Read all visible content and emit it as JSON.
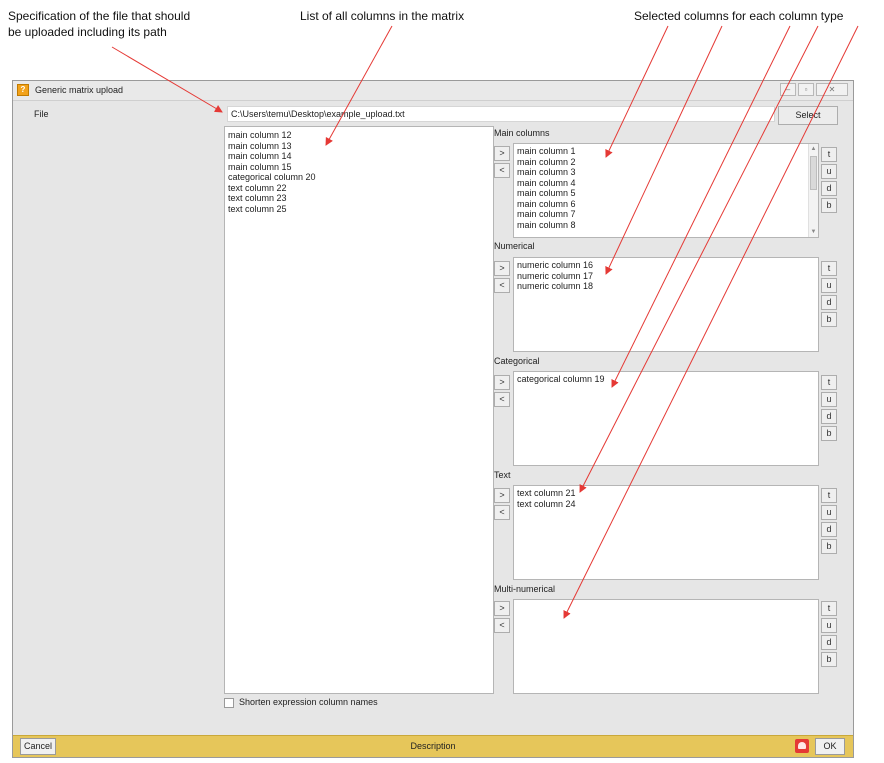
{
  "annotations": {
    "file_spec": [
      "Specification of the file that should",
      "be uploaded including its path"
    ],
    "all_columns": "List of all columns in the matrix",
    "selected_columns": "Selected columns for each column type"
  },
  "window": {
    "title": "Generic matrix upload",
    "app_icon": "app-logo-icon",
    "controls": [
      "minimize",
      "maximize",
      "close"
    ]
  },
  "file": {
    "label": "File",
    "path": "C:\\Users\\temu\\Desktop\\example_upload.txt",
    "select_label": "Select"
  },
  "all_columns": [
    "main column 12",
    "main column 13",
    "main column 14",
    "main column 15",
    "categorical column 20",
    "text column 22",
    "text column 23",
    "text column 25"
  ],
  "buttons": {
    "add": ">",
    "remove": "<",
    "top": "t",
    "up": "u",
    "down": "d",
    "bottom": "b"
  },
  "groups": [
    {
      "label": "Main columns",
      "items": [
        "main column 1",
        "main column 2",
        "main column 3",
        "main column 4",
        "main column 5",
        "main column 6",
        "main column 7",
        "main column 8"
      ],
      "scrollbar": true
    },
    {
      "label": "Numerical",
      "items": [
        "numeric column 16",
        "numeric column 17",
        "numeric column 18"
      ]
    },
    {
      "label": "Categorical",
      "items": [
        "categorical column 19"
      ]
    },
    {
      "label": "Text",
      "items": [
        "text column 21",
        "text column 24"
      ]
    },
    {
      "label": "Multi-numerical",
      "items": []
    }
  ],
  "options": {
    "shorten_label": "Shorten expression column names",
    "shorten_checked": false
  },
  "footer": {
    "cancel": "Cancel",
    "description": "Description",
    "ok": "OK",
    "accent": "#e6c65a",
    "warning_icon": "alert-icon"
  },
  "arrow_color": "#e53935"
}
